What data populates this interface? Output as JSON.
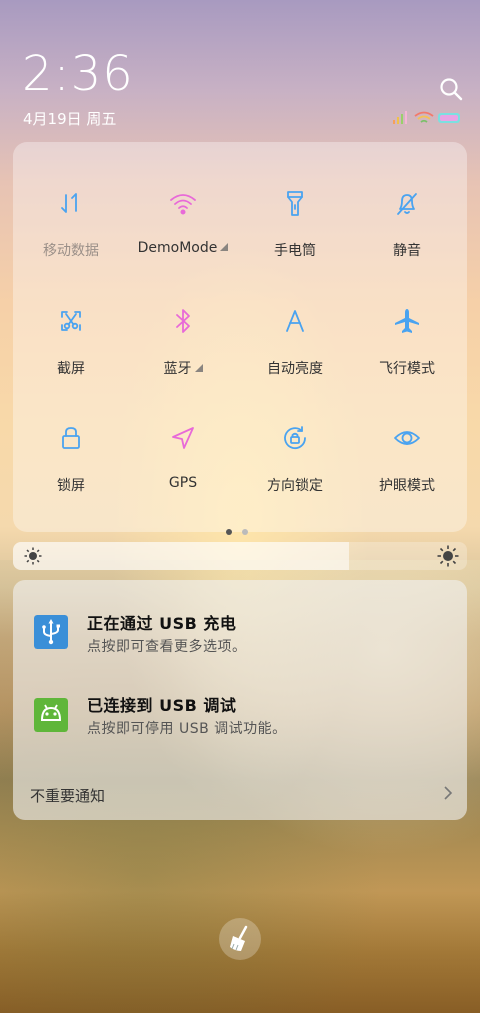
{
  "status": {
    "time": "2:36",
    "date": "4月19日 周五"
  },
  "quick_tiles": [
    {
      "label": "移动数据",
      "icon": "data-transfer-icon",
      "active": false,
      "dropdown": false
    },
    {
      "label": "DemoMode",
      "icon": "wifi-icon",
      "active": true,
      "dropdown": true
    },
    {
      "label": "手电筒",
      "icon": "flashlight-icon",
      "active": false,
      "dropdown": false
    },
    {
      "label": "静音",
      "icon": "bell-off-icon",
      "active": false,
      "dropdown": false
    },
    {
      "label": "截屏",
      "icon": "screenshot-icon",
      "active": false,
      "dropdown": false
    },
    {
      "label": "蓝牙",
      "icon": "bluetooth-icon",
      "active": true,
      "dropdown": true
    },
    {
      "label": "自动亮度",
      "icon": "auto-brightness-icon",
      "active": false,
      "dropdown": false
    },
    {
      "label": "飞行模式",
      "icon": "airplane-icon",
      "active": false,
      "dropdown": false
    },
    {
      "label": "锁屏",
      "icon": "lock-icon",
      "active": false,
      "dropdown": false
    },
    {
      "label": "GPS",
      "icon": "location-arrow-icon",
      "active": true,
      "dropdown": false
    },
    {
      "label": "方向锁定",
      "icon": "rotation-lock-icon",
      "active": false,
      "dropdown": false
    },
    {
      "label": "护眼模式",
      "icon": "eye-icon",
      "active": false,
      "dropdown": false
    }
  ],
  "pager": {
    "pages": 2,
    "current": 1
  },
  "brightness": {
    "level": 0.74
  },
  "notifications": [
    {
      "title": "正在通过  USB  充电",
      "subtitle": "点按即可查看更多选项。",
      "icon": "usb-icon",
      "icon_color": "#3a8fd8"
    },
    {
      "title": "已连接到  USB  调试",
      "subtitle": "点按即可停用 USB 调试功能。",
      "icon": "android-icon",
      "icon_color": "#5fb63a"
    }
  ],
  "minor_label": "不重要通知",
  "colors": {
    "tile_inactive": "#4aa3f0",
    "tile_active": "#e86ad8"
  }
}
